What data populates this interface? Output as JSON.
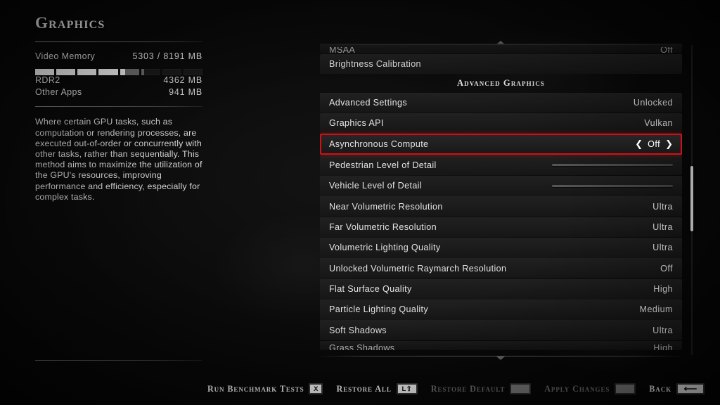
{
  "left_panel": {
    "title": "Graphics",
    "video_memory": {
      "label": "Video Memory",
      "value": "5303 / 8191 MB",
      "used_mb": 5303,
      "total_mb": 8191,
      "segments": 8
    },
    "breakdown": [
      {
        "label": "RDR2",
        "value": "4362 MB",
        "mb": 4362
      },
      {
        "label": "Other Apps",
        "value": "941 MB",
        "mb": 941
      }
    ],
    "description": "Where certain GPU tasks, such as computation or rendering processes, are executed out-of-order or concurrently with other tasks, rather than sequentially. This method aims to maximize the utilization of the GPU's resources, improving performance and efficiency, especially for complex tasks."
  },
  "settings_list": {
    "clipped_top": {
      "label": "MSAA",
      "value": "Off"
    },
    "rows": [
      {
        "type": "nav",
        "label": "Brightness Calibration",
        "value": ""
      },
      {
        "type": "header",
        "label": "Advanced Graphics",
        "value": ""
      },
      {
        "type": "value",
        "label": "Advanced Settings",
        "value": "Unlocked"
      },
      {
        "type": "value",
        "label": "Graphics API",
        "value": "Vulkan"
      },
      {
        "type": "stepper",
        "label": "Asynchronous Compute",
        "value": "Off",
        "selected": true
      },
      {
        "type": "slider",
        "label": "Pedestrian Level of Detail",
        "value": ""
      },
      {
        "type": "slider",
        "label": "Vehicle Level of Detail",
        "value": ""
      },
      {
        "type": "value",
        "label": "Near Volumetric Resolution",
        "value": "Ultra"
      },
      {
        "type": "value",
        "label": "Far Volumetric Resolution",
        "value": "Ultra"
      },
      {
        "type": "value",
        "label": "Volumetric Lighting Quality",
        "value": "Ultra"
      },
      {
        "type": "value",
        "label": "Unlocked Volumetric Raymarch Resolution",
        "value": "Off"
      },
      {
        "type": "value",
        "label": "Flat Surface Quality",
        "value": "High"
      },
      {
        "type": "value",
        "label": "Particle Lighting Quality",
        "value": "Medium"
      },
      {
        "type": "value",
        "label": "Soft Shadows",
        "value": "Ultra"
      }
    ],
    "clipped_bottom": {
      "label": "Grass Shadows",
      "value": "High"
    },
    "stepper_icons": {
      "left": "❮",
      "right": "❯"
    },
    "scroll": {
      "up_caret": "caret-up-icon",
      "down_caret": "caret-down-icon"
    }
  },
  "footer": {
    "buttons": [
      {
        "label": "Run Benchmark Tests",
        "key": "X",
        "key_style": "letter",
        "disabled": false
      },
      {
        "label": "Restore All",
        "key": "L⇧",
        "key_style": "combo",
        "disabled": false
      },
      {
        "label": "Restore Default",
        "key": "",
        "key_style": "blank",
        "disabled": true
      },
      {
        "label": "Apply Changes",
        "key": "",
        "key_style": "blank",
        "disabled": true
      },
      {
        "label": "Back",
        "key": "⟵",
        "key_style": "arrow",
        "disabled": false
      }
    ]
  },
  "colors": {
    "selection_red": "#d10f18",
    "row_background": "#1d1d1d",
    "text_primary": "#e8e8e8",
    "text_disabled": "#6d6d6d",
    "bar_full": "#f0f0f0",
    "bar_other": "#6e6e6e"
  }
}
